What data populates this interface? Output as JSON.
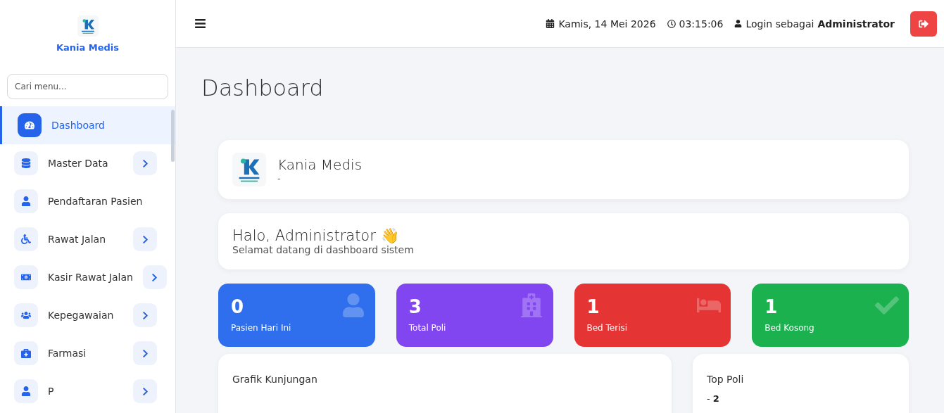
{
  "brand": {
    "name": "Kania Medis"
  },
  "sidebar": {
    "search": {
      "placeholder": "Cari menu..."
    },
    "items": [
      {
        "label": "Dashboard",
        "selected": true,
        "expandable": false
      },
      {
        "label": "Master Data",
        "selected": false,
        "expandable": true
      },
      {
        "label": "Pendaftaran Pasien",
        "selected": false,
        "expandable": false
      },
      {
        "label": "Rawat Jalan",
        "selected": false,
        "expandable": true
      },
      {
        "label": "Kasir Rawat Jalan",
        "selected": false,
        "expandable": true
      },
      {
        "label": "Kepegawaian",
        "selected": false,
        "expandable": true
      },
      {
        "label": "Farmasi",
        "selected": false,
        "expandable": true
      },
      {
        "label": "P",
        "selected": false,
        "expandable": true
      }
    ]
  },
  "topbar": {
    "date": "Kamis, 14 Mei 2026",
    "time": "03:15:06",
    "login_prefix": "Login sebagai",
    "user": "Administrator"
  },
  "page_title": "Dashboard",
  "profile_card": {
    "name": "Kania Medis",
    "subtitle": "-"
  },
  "greeting_card": {
    "title": "Halo, Administrator 👋",
    "subtitle": "Selamat datang di dashboard sistem"
  },
  "stats": [
    {
      "value": "0",
      "label": "Pasien Hari Ini",
      "color": "#2f6fed"
    },
    {
      "value": "3",
      "label": "Total Poli",
      "color": "#8146f0"
    },
    {
      "value": "1",
      "label": "Bed Terisi",
      "color": "#e53434"
    },
    {
      "value": "1",
      "label": "Bed Kosong",
      "color": "#1bb14f"
    }
  ],
  "visit_chart": {
    "title": "Grafik Kunjungan"
  },
  "top_poli": {
    "title": "Top Poli",
    "entries": [
      "- **2**"
    ]
  }
}
